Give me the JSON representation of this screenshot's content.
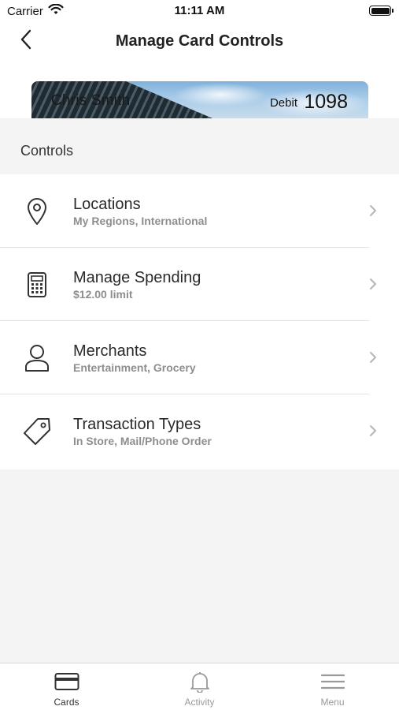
{
  "status_bar": {
    "carrier": "Carrier",
    "time": "11:11 AM"
  },
  "nav": {
    "title": "Manage Card Controls",
    "back_icon": "chevron-left-icon"
  },
  "card": {
    "holder_name": "Chris Smith",
    "card_type": "Debit",
    "last_four": "1098"
  },
  "section": {
    "title": "Controls"
  },
  "controls": [
    {
      "label": "Locations",
      "subtitle": "My Regions, International",
      "icon": "location-pin-icon"
    },
    {
      "label": "Manage Spending",
      "subtitle": "$12.00 limit",
      "icon": "calculator-icon"
    },
    {
      "label": "Merchants",
      "subtitle": "Entertainment, Grocery",
      "icon": "person-icon"
    },
    {
      "label": "Transaction Types",
      "subtitle": "In Store, Mail/Phone Order",
      "icon": "tag-icon"
    }
  ],
  "tab_bar": {
    "tabs": [
      {
        "label": "Cards",
        "icon": "card-icon",
        "active": true
      },
      {
        "label": "Activity",
        "icon": "bell-icon",
        "active": false
      },
      {
        "label": "Menu",
        "icon": "hamburger-menu-icon",
        "active": false
      }
    ]
  },
  "colors": {
    "background": "#f4f4f4",
    "surface": "#ffffff",
    "text_primary": "#2a2a2a",
    "text_secondary": "#8e8e8e",
    "divider": "#e2e2e2"
  }
}
